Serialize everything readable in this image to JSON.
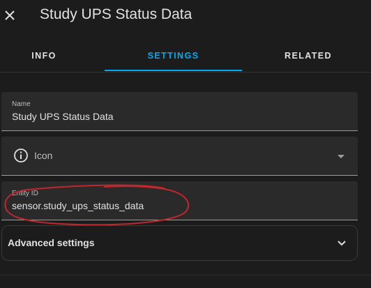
{
  "header": {
    "title": "Study UPS Status Data"
  },
  "tabs": [
    {
      "label": "INFO"
    },
    {
      "label": "SETTINGS",
      "active": true
    },
    {
      "label": "RELATED"
    }
  ],
  "form": {
    "name": {
      "label": "Name",
      "value": "Study UPS Status Data"
    },
    "icon": {
      "placeholder": "Icon"
    },
    "entity_id": {
      "label": "Entity ID",
      "value": "sensor.study_ups_status_data"
    }
  },
  "advanced": {
    "label": "Advanced settings"
  },
  "colors": {
    "accent": "#03a9f4",
    "background": "#1c1c1c",
    "field_background": "#2a2a2a",
    "annotation": "#c0282d"
  },
  "icons": {
    "close": "close-icon",
    "field_icon": "information-outline-icon",
    "dropdown": "menu-down-icon",
    "expand": "chevron-down-icon"
  }
}
